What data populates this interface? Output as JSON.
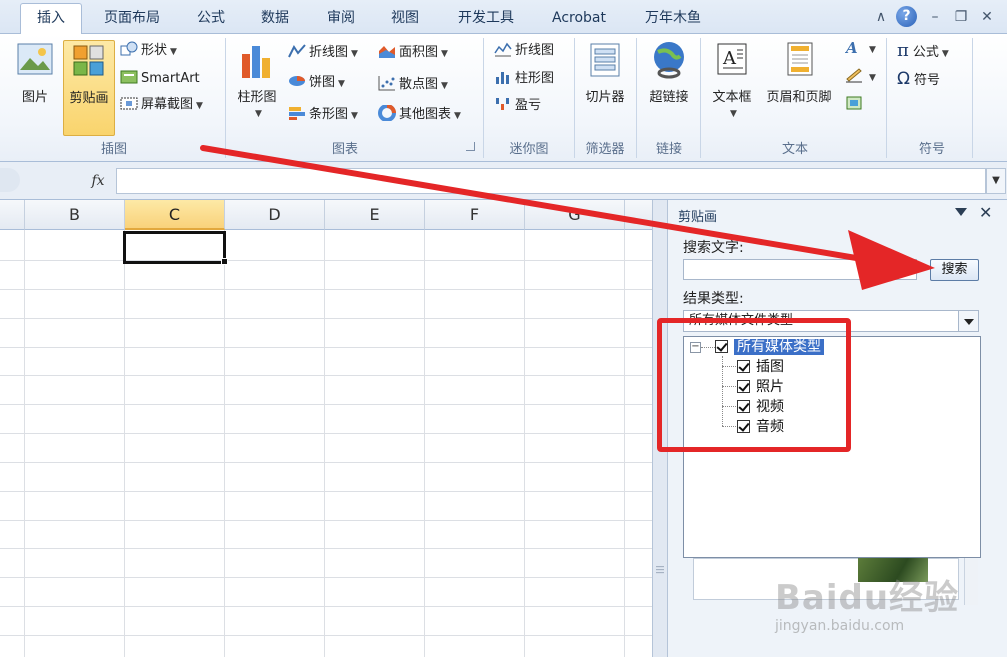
{
  "tabs": [
    "插入",
    "页面布局",
    "公式",
    "数据",
    "审阅",
    "视图",
    "开发工具",
    "Acrobat",
    "万年木鱼"
  ],
  "active_tab": "插入",
  "window_controls": {
    "collapse": "∧",
    "help": "?",
    "minimize": "–",
    "restore": "❐",
    "close": "✕"
  },
  "ribbon": {
    "illustrations": {
      "label": "插图",
      "picture": "图片",
      "clipart": "剪贴画",
      "shapes": "形状",
      "smartart": "SmartArt",
      "screenshot": "屏幕截图"
    },
    "charts": {
      "label": "图表",
      "column": "柱形图",
      "line": "折线图",
      "pie": "饼图",
      "bar": "条形图",
      "area": "面积图",
      "scatter": "散点图",
      "other": "其他图表"
    },
    "sparklines": {
      "label": "迷你图",
      "line": "折线图",
      "column": "柱形图",
      "winloss": "盈亏"
    },
    "filter": {
      "label": "筛选器",
      "slicer": "切片器"
    },
    "links": {
      "label": "链接",
      "hyperlink": "超链接"
    },
    "text": {
      "label": "文本",
      "textbox": "文本框",
      "header_footer": "页眉和页脚"
    },
    "symbols": {
      "label": "符号",
      "equation": "公式",
      "symbol": "符号",
      "pi": "π",
      "omega": "Ω"
    }
  },
  "formula_bar": {
    "fx": "fx",
    "value": ""
  },
  "grid": {
    "columns": [
      "B",
      "C",
      "D",
      "E",
      "F",
      "G"
    ],
    "selected_column": "C"
  },
  "clipart_pane": {
    "title": "剪贴画",
    "search_label": "搜索文字:",
    "search_value": "",
    "search_button": "搜索",
    "result_type_label": "结果类型:",
    "result_type_value": "所有媒体文件类型",
    "tree_root": "所有媒体类型",
    "tree_items": [
      "插图",
      "照片",
      "视频",
      "音频"
    ]
  },
  "watermark": {
    "main": "Baidu经验",
    "sub": "jingyan.baidu.com"
  },
  "colors": {
    "annotation": "#e42627",
    "ribbon_accent": "#f9d46d",
    "selection": "#3b6fc7"
  }
}
